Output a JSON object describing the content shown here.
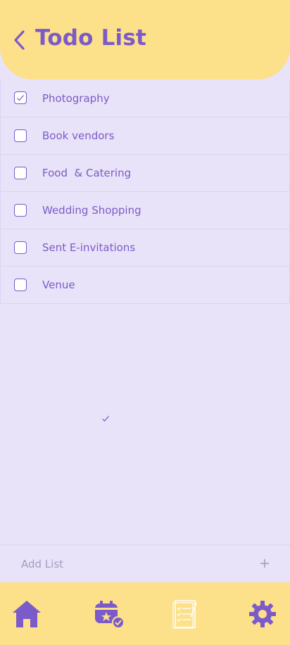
{
  "header": {
    "title": "Todo List"
  },
  "todos": [
    {
      "label": "Photography",
      "checked": true
    },
    {
      "label": "Book vendors",
      "checked": false
    },
    {
      "label": "Food  & Catering",
      "checked": false
    },
    {
      "label": "Wedding Shopping",
      "checked": false
    },
    {
      "label": "Sent E-invitations",
      "checked": false
    },
    {
      "label": "Venue",
      "checked": false
    }
  ],
  "add_list": {
    "placeholder": "Add List"
  },
  "bottom_nav": [
    "home-icon",
    "event-calendar-check-icon",
    "checklist-document-icon",
    "gear-icon"
  ],
  "colors": {
    "accent": "#7b5bc9",
    "header_bg": "#fde08a",
    "page_bg": "#e8e3f8"
  }
}
